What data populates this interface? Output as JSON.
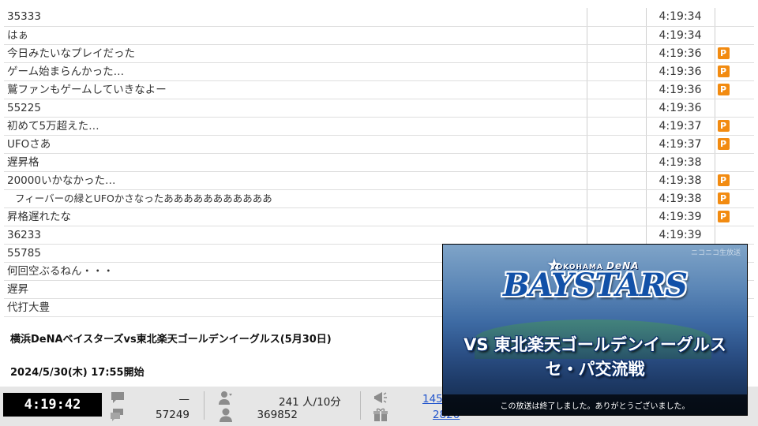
{
  "comments": [
    {
      "text": "35333",
      "time": "4:19:34",
      "premium": false,
      "indent": false
    },
    {
      "text": "はぁ",
      "time": "4:19:34",
      "premium": false,
      "indent": false
    },
    {
      "text": "今日みたいなプレイだった",
      "time": "4:19:36",
      "premium": true,
      "indent": false
    },
    {
      "text": "ゲーム始まらんかった…",
      "time": "4:19:36",
      "premium": true,
      "indent": false
    },
    {
      "text": "鷲ファンもゲームしていきなよー",
      "time": "4:19:36",
      "premium": true,
      "indent": false
    },
    {
      "text": "55225",
      "time": "4:19:36",
      "premium": false,
      "indent": false
    },
    {
      "text": "初めて5万超えた…",
      "time": "4:19:37",
      "premium": true,
      "indent": false
    },
    {
      "text": "UFOさあ",
      "time": "4:19:37",
      "premium": true,
      "indent": false
    },
    {
      "text": "遅昇格",
      "time": "4:19:38",
      "premium": false,
      "indent": false
    },
    {
      "text": "20000いかなかった…",
      "time": "4:19:38",
      "premium": true,
      "indent": false
    },
    {
      "text": "フィーバーの緑とUFOかさなったあああああああああああ",
      "time": "4:19:38",
      "premium": true,
      "indent": true
    },
    {
      "text": "昇格遅れたな",
      "time": "4:19:39",
      "premium": true,
      "indent": false
    },
    {
      "text": "36233",
      "time": "4:19:39",
      "premium": false,
      "indent": false
    },
    {
      "text": "55785",
      "time": "",
      "premium": false,
      "indent": false
    },
    {
      "text": "何回空ぶるねん・・・",
      "time": "",
      "premium": false,
      "indent": false
    },
    {
      "text": "遅昇",
      "time": "",
      "premium": false,
      "indent": false
    },
    {
      "text": "代打大豊",
      "time": "",
      "premium": false,
      "indent": false
    }
  ],
  "premium_badge_label": "P",
  "program": {
    "title": "横浜DeNAベイスターズvs東北楽天ゴールデンイーグルス(5月30日)",
    "start": "2024/5/30(木) 17:55開始"
  },
  "status": {
    "elapsed": "4:19:42",
    "comment_rate": "—",
    "comment_total": "57249",
    "viewer_rate": "241 人/10分",
    "viewer_total": "369852",
    "ad_points": "145",
    "gift_points": "2820"
  },
  "video": {
    "watermark": "ニコニコ生放送",
    "logo_small": "YOKOHAMA",
    "logo_dena": "DeNA",
    "logo_big": "BAYSTARS",
    "title_line1": "VS 東北楽天ゴールデンイーグルス",
    "title_line2": "セ・パ交流戦",
    "caption": "この放送は終了しました。ありがとうございました。"
  },
  "colors": {
    "premium_badge": "#f28b11",
    "timer_bg": "#000000",
    "link": "#2255cc",
    "logo_blue": "#1251a8"
  }
}
